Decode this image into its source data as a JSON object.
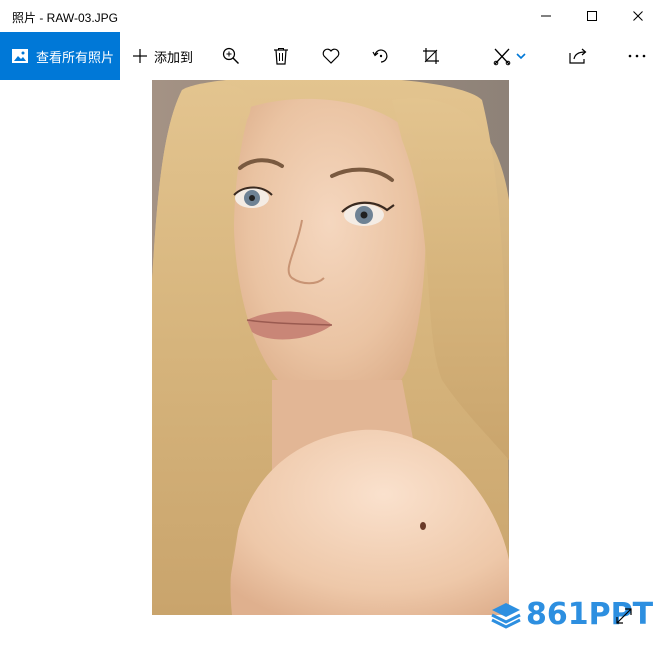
{
  "window": {
    "title": "照片 - RAW-03.JPG",
    "controls": [
      "minimize-icon",
      "maximize-icon",
      "close-icon"
    ]
  },
  "toolbar": {
    "view_all_label": "查看所有照片",
    "view_all_icon": "photo-icon",
    "add_to_label": "添加到",
    "add_to_icon": "plus-icon",
    "tools": [
      "zoom-in-icon",
      "delete-icon",
      "favorite-icon",
      "rotate-icon",
      "crop-icon",
      "edit-icon",
      "share-icon",
      "more-icon"
    ],
    "accent_color": "#0078d7"
  },
  "watermark": {
    "text": "861PPT",
    "color": "#2d8fe0"
  },
  "fullscreen_icon": "expand-icon"
}
